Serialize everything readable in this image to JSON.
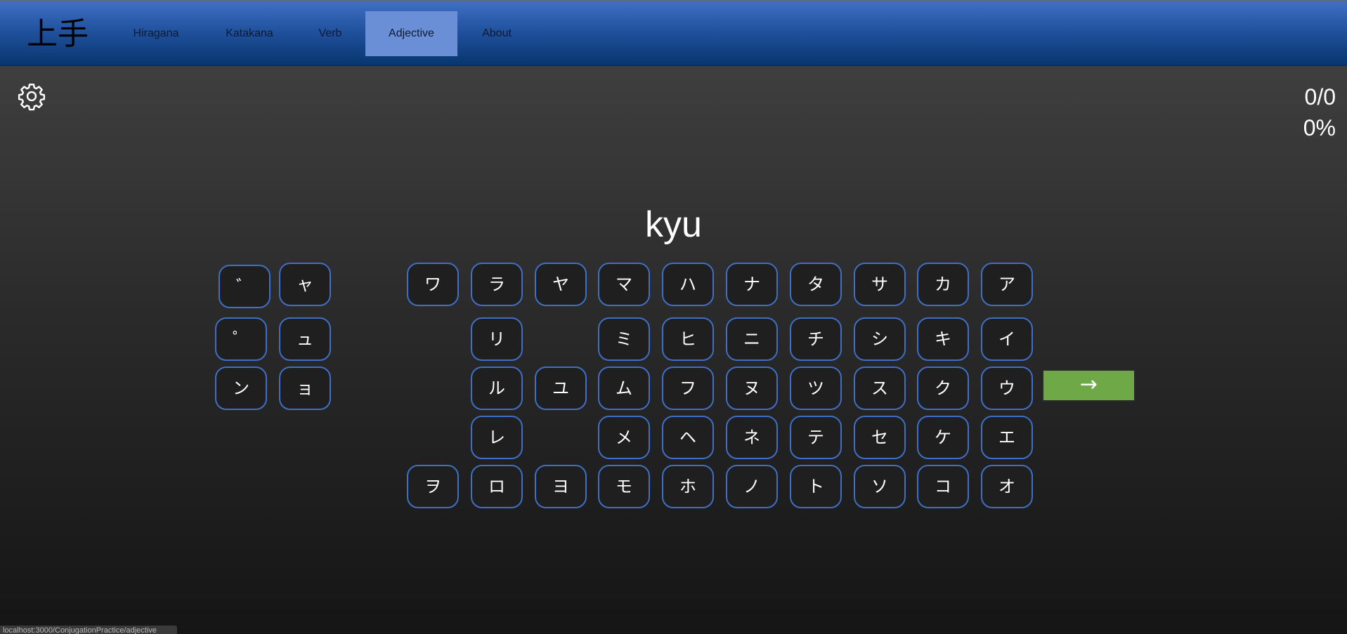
{
  "brand": "上手",
  "nav": [
    {
      "label": "Hiragana",
      "active": false
    },
    {
      "label": "Katakana",
      "active": false
    },
    {
      "label": "Verb",
      "active": false
    },
    {
      "label": "Adjective",
      "active": true
    },
    {
      "label": "About",
      "active": false
    }
  ],
  "settings_icon": "gear-icon",
  "score": {
    "count": "0/0",
    "percent": "0%"
  },
  "prompt": "kyu",
  "modifier_keys": [
    "゛",
    "ャ",
    "゜",
    "ュ",
    "ン",
    "ョ"
  ],
  "kana_keys": [
    [
      "ワ",
      "ラ",
      "ヤ",
      "マ",
      "ハ",
      "ナ",
      "タ",
      "サ",
      "カ",
      "ア"
    ],
    [
      "",
      "リ",
      "",
      "ミ",
      "ヒ",
      "ニ",
      "チ",
      "シ",
      "キ",
      "イ"
    ],
    [
      "",
      "ル",
      "ユ",
      "ム",
      "フ",
      "ヌ",
      "ツ",
      "ス",
      "ク",
      "ウ"
    ],
    [
      "",
      "レ",
      "",
      "メ",
      "ヘ",
      "ネ",
      "テ",
      "セ",
      "ケ",
      "エ"
    ],
    [
      "ヲ",
      "ロ",
      "ヨ",
      "モ",
      "ホ",
      "ノ",
      "ト",
      "ソ",
      "コ",
      "オ"
    ]
  ],
  "next_button": "→",
  "status_url": "localhost:3000/ConjugationPractice/adjective",
  "colors": {
    "accent": "#3f6fc7",
    "next": "#6fa847",
    "nav_active": "#6a8fd6"
  }
}
